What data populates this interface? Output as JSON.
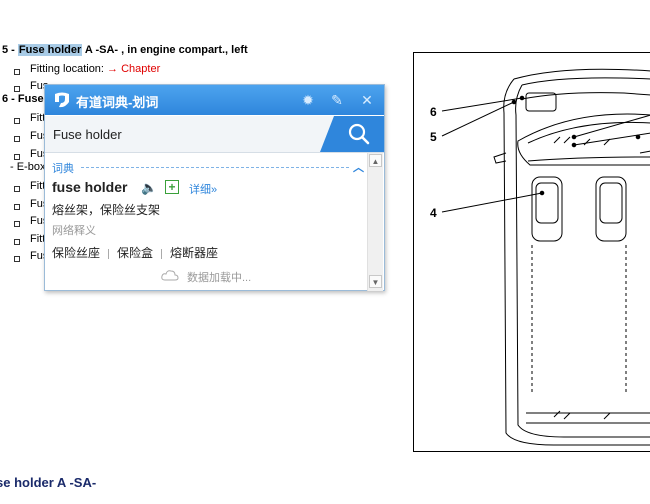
{
  "document": {
    "item5": {
      "num": "5 -",
      "highlight": "Fuse holder",
      "rest": " A -SA- , in engine compart., left"
    },
    "fitting_label": "Fitting location:",
    "chapter_link": "→ Chapter",
    "item6": {
      "num": "6 -",
      "partial": "Fuse"
    },
    "frag_fitt": "Fitt",
    "frag_fus": "Fus",
    "frag_ebox": "- E-box",
    "bottom_title": "se holder A -SA-"
  },
  "diagram": {
    "callouts": [
      "6",
      "5",
      "4"
    ]
  },
  "popup": {
    "title": "有道词典-划词",
    "search": {
      "value": "Fuse holder"
    },
    "section_label": "词典",
    "word": "fuse holder",
    "detail_link": "详细»",
    "translation": "熔丝架，保险丝支架",
    "net_label": "网络释义",
    "terms": [
      "保险丝座",
      "保险盒",
      "熔断器座"
    ],
    "loading": "数据加载中..."
  }
}
